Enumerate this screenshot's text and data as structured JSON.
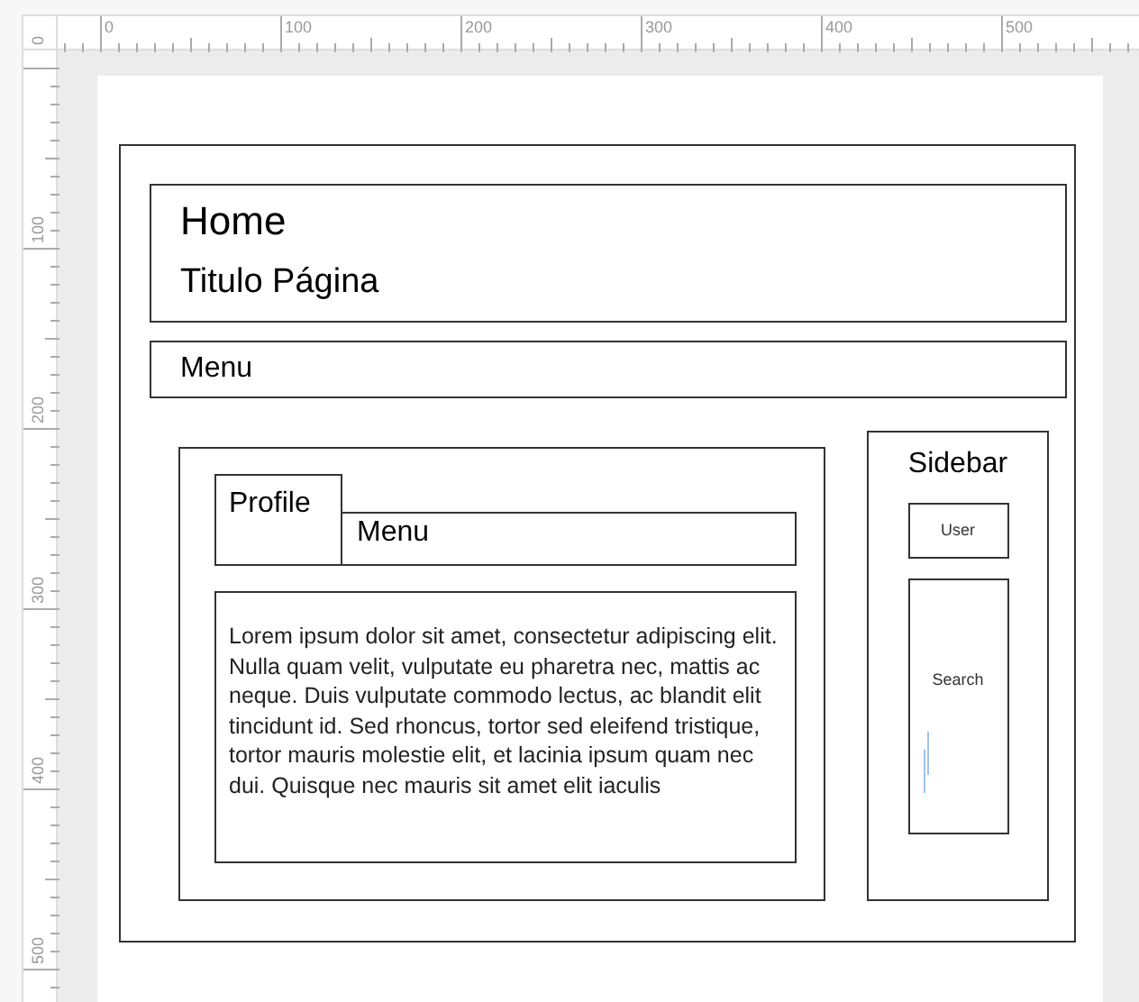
{
  "rulers": {
    "horizontal": [
      "0",
      "100",
      "200",
      "300",
      "400",
      "500"
    ],
    "vertical": [
      "0",
      "100",
      "200",
      "300",
      "400",
      "500"
    ]
  },
  "wireframe": {
    "header": {
      "title": "Home",
      "subtitle": "Titulo Página"
    },
    "menu": "Menu",
    "content": {
      "tab": "Profile",
      "tab_menu": "Menu",
      "body": "Lorem ipsum dolor sit amet, consectetur adipiscing elit. Nulla quam velit, vulputate eu pharetra nec, mattis ac neque. Duis vulputate commodo lectus, ac blandit elit tincidunt id. Sed rhoncus, tortor sed eleifend tristique, tortor mauris molestie elit, et lacinia ipsum quam nec dui. Quisque nec mauris sit amet elit iaculis"
    },
    "sidebar": {
      "title": "Sidebar",
      "button": "User",
      "search": "Search"
    }
  }
}
